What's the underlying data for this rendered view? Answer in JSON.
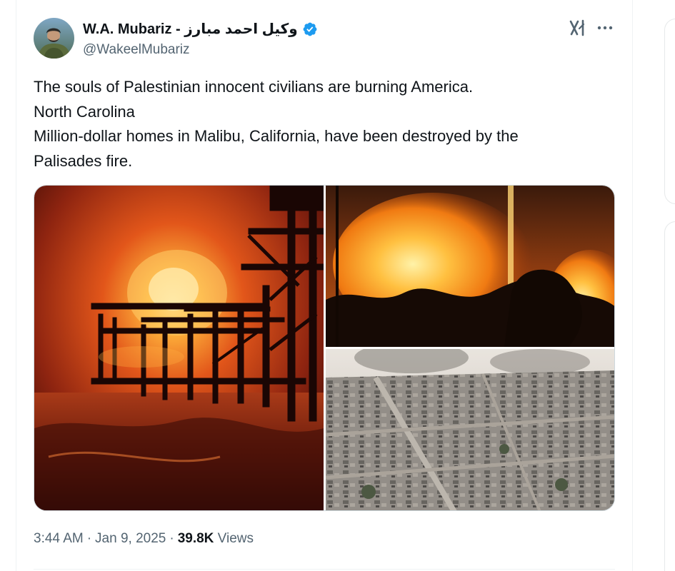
{
  "author": {
    "display_name": "W.A. Mubariz - وکیل احمد مبارز",
    "handle": "@WakeelMubariz",
    "verified": true
  },
  "tweet": {
    "lines": [
      "The souls of Palestinian innocent civilians are burning America.",
      "North Carolina",
      "Million-dollar homes in Malibu, California, have been destroyed by the",
      "Palisades fire."
    ]
  },
  "meta": {
    "time": "3:44 AM",
    "separator": "·",
    "date": "Jan 9, 2025",
    "views_count": "39.8K",
    "views_label": "Views"
  },
  "icons": {
    "verified": "verified-badge-icon",
    "grok": "grok-icon",
    "more": "more-options-icon"
  },
  "colors": {
    "verified": "#1d9bf0",
    "secondary_text": "#536471",
    "primary_text": "#0f1419"
  }
}
